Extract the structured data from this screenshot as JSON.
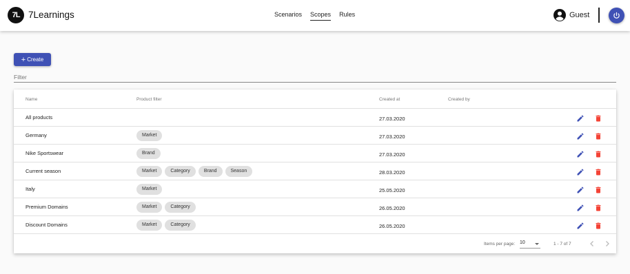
{
  "app": {
    "brand": "7Learnings",
    "logo_text": "7L"
  },
  "nav": {
    "items": [
      "Scenarios",
      "Scopes",
      "Rules"
    ],
    "active": "Scopes"
  },
  "user": {
    "name": "Guest",
    "icon": "account-circle-icon"
  },
  "actions": {
    "create_label": "Create",
    "power_icon": "power-icon"
  },
  "filter": {
    "placeholder": "Filter",
    "value": ""
  },
  "table": {
    "headers": {
      "name": "Name",
      "product_filter": "Product filter",
      "created_at": "Created at",
      "created_by": "Created by"
    },
    "rows": [
      {
        "name": "All products",
        "filters": [],
        "created_at": "27.03.2020",
        "created_by": ""
      },
      {
        "name": "Germany",
        "filters": [
          "Market"
        ],
        "created_at": "27.03.2020",
        "created_by": ""
      },
      {
        "name": "Nike Sportswear",
        "filters": [
          "Brand"
        ],
        "created_at": "27.03.2020",
        "created_by": ""
      },
      {
        "name": "Current season",
        "filters": [
          "Market",
          "Category",
          "Brand",
          "Season"
        ],
        "created_at": "28.03.2020",
        "created_by": ""
      },
      {
        "name": "Italy",
        "filters": [
          "Market"
        ],
        "created_at": "25.05.2020",
        "created_by": ""
      },
      {
        "name": "Premium Domains",
        "filters": [
          "Market",
          "Category"
        ],
        "created_at": "26.05.2020",
        "created_by": ""
      },
      {
        "name": "Discount Domains",
        "filters": [
          "Market",
          "Category"
        ],
        "created_at": "26.05.2020",
        "created_by": ""
      }
    ],
    "row_actions": {
      "edit_icon": "pencil-icon",
      "delete_icon": "trash-icon"
    }
  },
  "paginator": {
    "items_per_page_label": "Items per page:",
    "page_size": "10",
    "range_label": "1 - 7 of 7"
  },
  "colors": {
    "primary": "#3f51b5",
    "delete": "#f44336",
    "chip": "#e0e0e0"
  }
}
